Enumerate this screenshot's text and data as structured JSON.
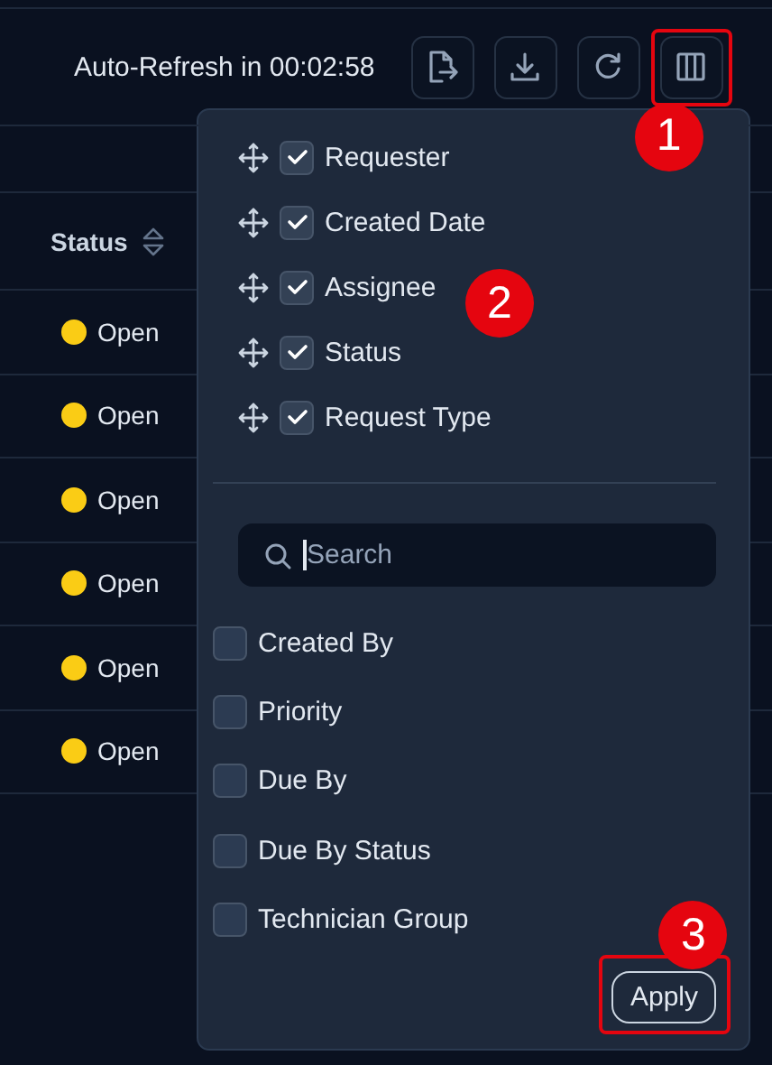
{
  "toolbar": {
    "auto_refresh": "Auto-Refresh in 00:02:58",
    "buttons": [
      {
        "kind": "export",
        "highlighted": false
      },
      {
        "kind": "download",
        "highlighted": false
      },
      {
        "kind": "refresh",
        "highlighted": false
      },
      {
        "kind": "columns",
        "highlighted": true,
        "callout": "1"
      }
    ]
  },
  "table": {
    "header": "Status",
    "rows": [
      {
        "status": "Open"
      },
      {
        "status": "Open"
      },
      {
        "status": "Open"
      },
      {
        "status": "Open"
      },
      {
        "status": "Open"
      },
      {
        "status": "Open"
      }
    ]
  },
  "column_menu": {
    "shown_columns": [
      {
        "label": "Requester",
        "checked": true
      },
      {
        "label": "Created Date",
        "checked": true
      },
      {
        "label": "Assignee",
        "checked": true,
        "callout": "2"
      },
      {
        "label": "Status",
        "checked": true
      },
      {
        "label": "Request Type",
        "checked": true
      }
    ],
    "search": {
      "placeholder": "Search",
      "focused": true
    },
    "other_columns": [
      {
        "label": "Created By",
        "checked": false
      },
      {
        "label": "Priority",
        "checked": false
      },
      {
        "label": "Due By",
        "checked": false
      },
      {
        "label": "Due By Status",
        "checked": false
      },
      {
        "label": "Technician Group",
        "checked": false
      }
    ],
    "apply": {
      "label": "Apply",
      "highlighted": true,
      "callout": "3"
    }
  }
}
